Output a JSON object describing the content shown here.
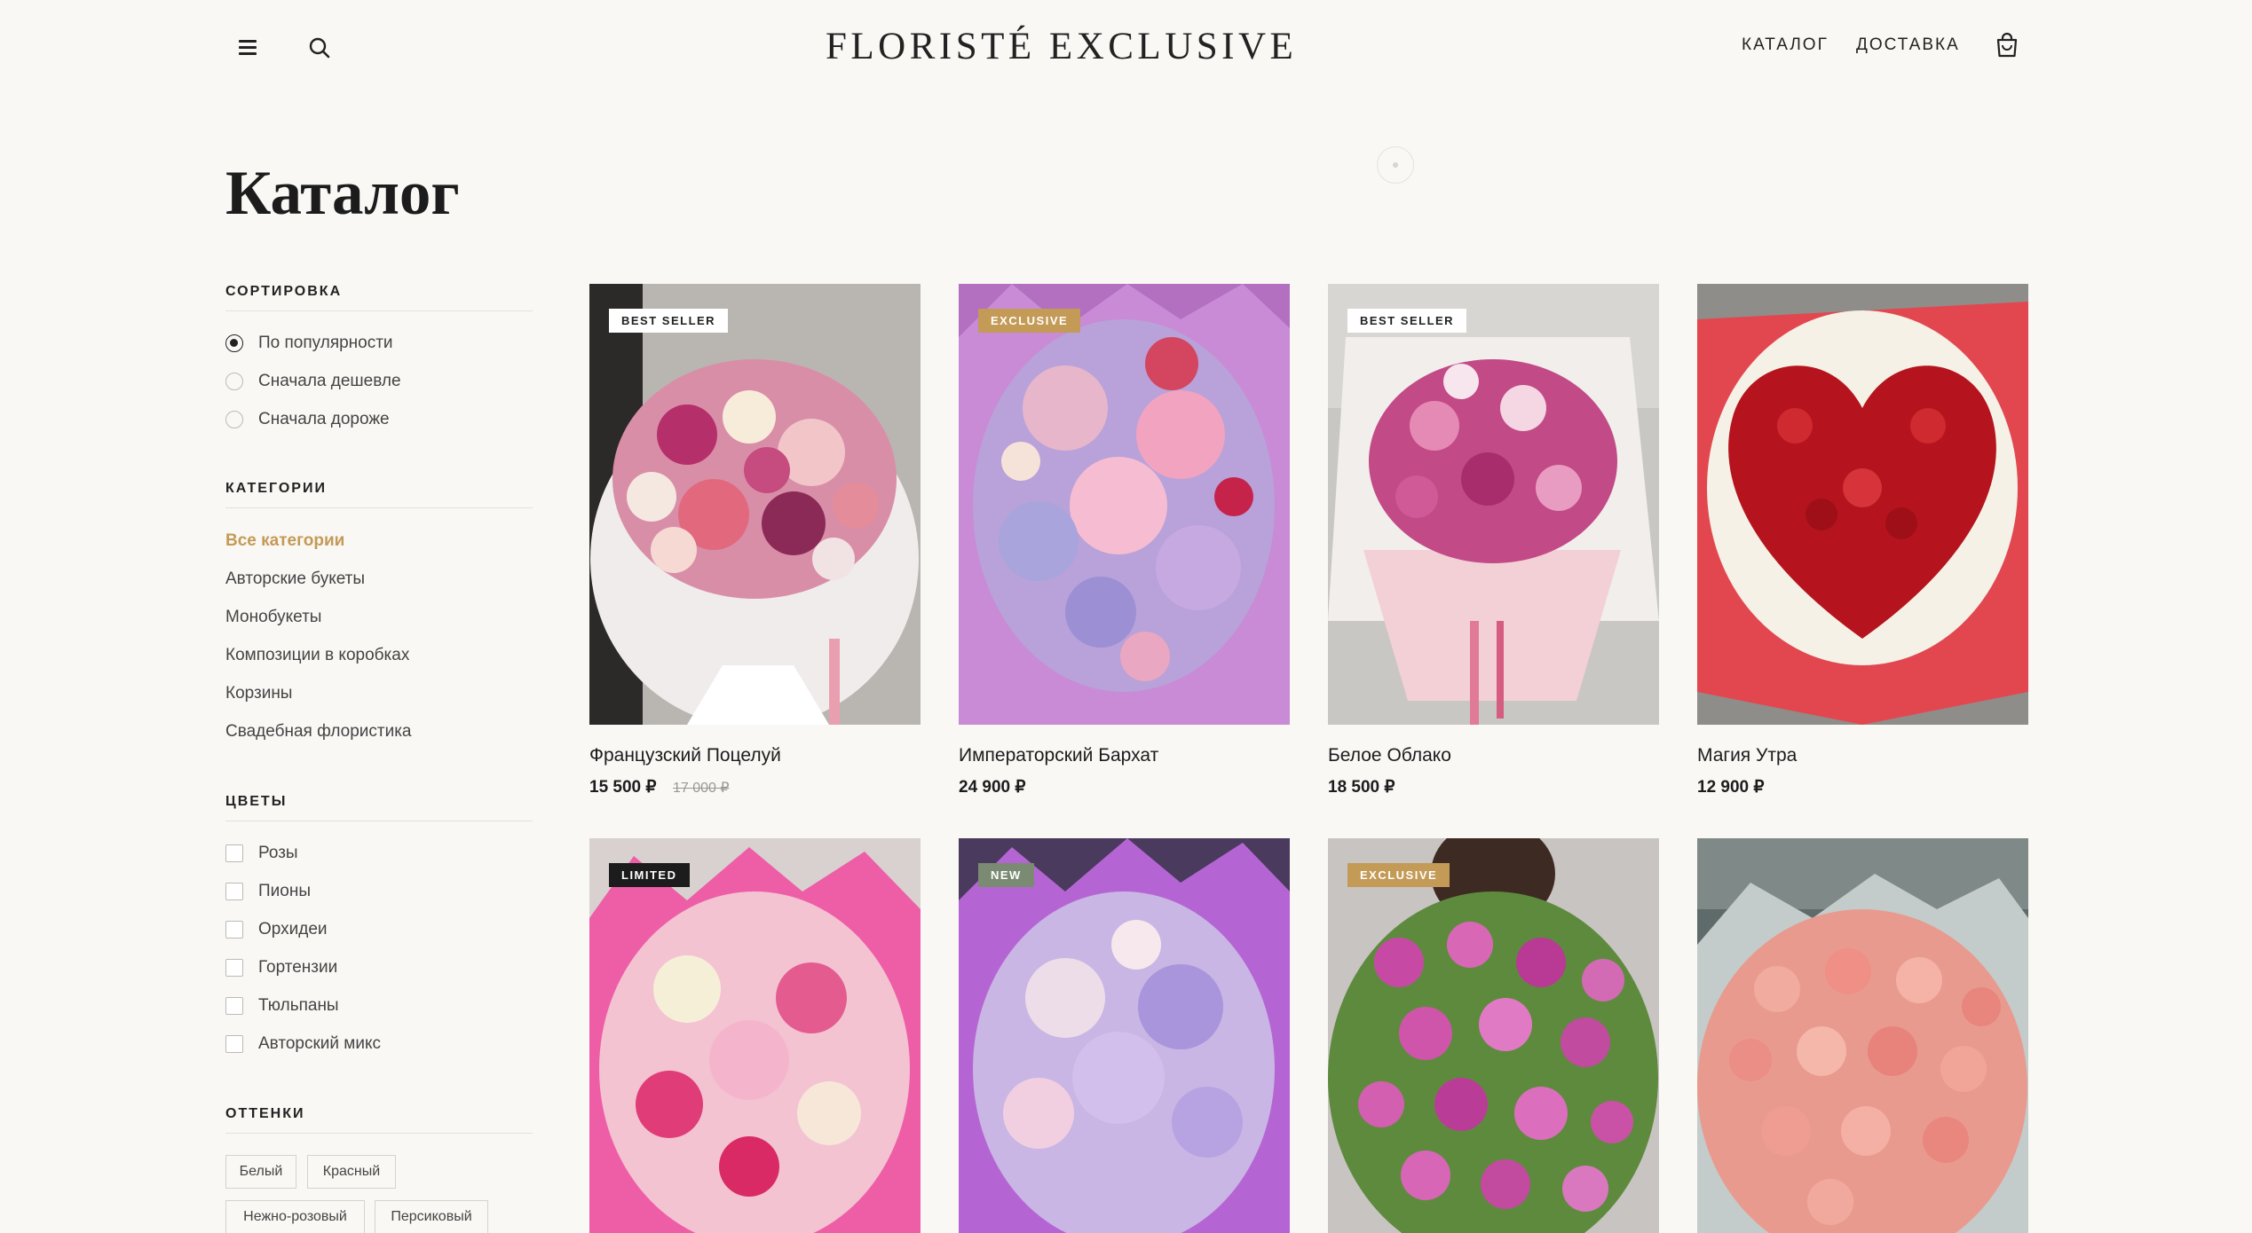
{
  "brand": {
    "logo": "FLORISTÉ EXCLUSIVE"
  },
  "header": {
    "nav": [
      "КАТАЛОГ",
      "ДОСТАВКА"
    ],
    "icons": [
      "menu-icon",
      "search-icon",
      "cart-icon"
    ]
  },
  "page": {
    "title": "Каталог"
  },
  "sidebar": {
    "sort": {
      "title": "СОРТИРОВКА",
      "options": [
        "По популярности",
        "Сначала дешевле",
        "Сначала дороже"
      ],
      "selected": "По популярности"
    },
    "categories": {
      "title": "КАТЕГОРИИ",
      "items": [
        "Все категории",
        "Авторские букеты",
        "Монобукеты",
        "Композиции в коробках",
        "Корзины",
        "Свадебная флористика"
      ],
      "active": "Все категории"
    },
    "flowers": {
      "title": "ЦВЕТЫ",
      "items": [
        "Розы",
        "Пионы",
        "Орхидеи",
        "Гортензии",
        "Тюльпаны",
        "Авторский микс"
      ]
    },
    "shades": {
      "title": "ОТТЕНКИ",
      "items": [
        "Белый",
        "Красный",
        "Нежно-розовый",
        "Персиковый"
      ]
    }
  },
  "products": [
    {
      "name": "Французский Поцелуй",
      "price": "15 500 ₽",
      "old_price": "17 000 ₽",
      "badge": "BEST SELLER"
    },
    {
      "name": "Императорский Бархат",
      "price": "24 900 ₽",
      "old_price": "",
      "badge": "EXCLUSIVE"
    },
    {
      "name": "Белое Облако",
      "price": "18 500 ₽",
      "old_price": "",
      "badge": "BEST SELLER"
    },
    {
      "name": "Магия Утра",
      "price": "12 900 ₽",
      "old_price": "",
      "badge": ""
    },
    {
      "name": "",
      "price": "",
      "old_price": "",
      "badge": "LIMITED"
    },
    {
      "name": "",
      "price": "",
      "old_price": "",
      "badge": "NEW"
    },
    {
      "name": "",
      "price": "",
      "old_price": "",
      "badge": "EXCLUSIVE"
    },
    {
      "name": "",
      "price": "",
      "old_price": "",
      "badge": ""
    }
  ],
  "colors": {
    "accent": "#c49a57",
    "background": "#f9f8f5",
    "text": "#1c1c1c"
  }
}
